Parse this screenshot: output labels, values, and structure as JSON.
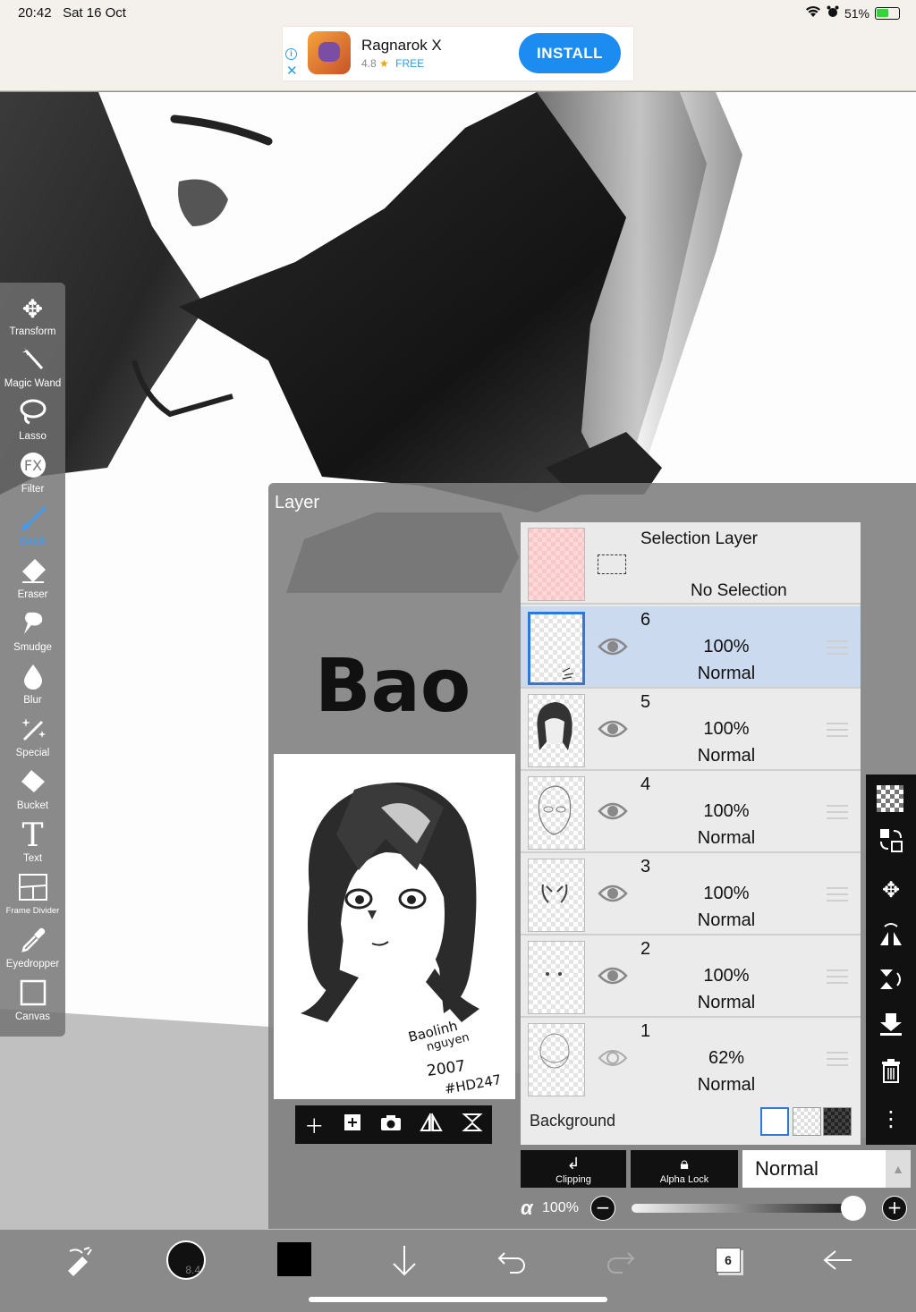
{
  "status_bar": {
    "time": "20:42",
    "date": "Sat 16 Oct",
    "battery": "51%"
  },
  "ad": {
    "title": "Ragnarok X",
    "rating": "4.8",
    "star": "★",
    "price": "FREE",
    "cta": "INSTALL"
  },
  "artwork": {
    "signature_lettering": "Bao"
  },
  "tools": [
    {
      "id": "transform",
      "label": "Transform",
      "icon": "move-icon"
    },
    {
      "id": "magic-wand",
      "label": "Magic Wand",
      "icon": "magic-wand-icon"
    },
    {
      "id": "lasso",
      "label": "Lasso",
      "icon": "lasso-icon"
    },
    {
      "id": "filter",
      "label": "Filter",
      "icon": "fx-icon"
    },
    {
      "id": "brush",
      "label": "Brush",
      "icon": "brush-icon",
      "active": true
    },
    {
      "id": "eraser",
      "label": "Eraser",
      "icon": "eraser-icon"
    },
    {
      "id": "smudge",
      "label": "Smudge",
      "icon": "smudge-icon"
    },
    {
      "id": "blur",
      "label": "Blur",
      "icon": "drop-icon"
    },
    {
      "id": "special",
      "label": "Special",
      "icon": "sparkle-icon"
    },
    {
      "id": "bucket",
      "label": "Bucket",
      "icon": "bucket-icon"
    },
    {
      "id": "text",
      "label": "Text",
      "icon": "text-icon"
    },
    {
      "id": "frame-divider",
      "label": "Frame Divider",
      "icon": "frame-icon"
    },
    {
      "id": "eyedropper",
      "label": "Eyedropper",
      "icon": "eyedropper-icon"
    },
    {
      "id": "canvas",
      "label": "Canvas",
      "icon": "canvas-icon"
    }
  ],
  "layer_panel": {
    "title": "Layer",
    "selection_layer": {
      "name": "Selection Layer",
      "state": "No Selection"
    },
    "layers": [
      {
        "num": "6",
        "opacity": "100%",
        "blend": "Normal",
        "selected": true,
        "visible": true
      },
      {
        "num": "5",
        "opacity": "100%",
        "blend": "Normal",
        "selected": false,
        "visible": true
      },
      {
        "num": "4",
        "opacity": "100%",
        "blend": "Normal",
        "selected": false,
        "visible": true
      },
      {
        "num": "3",
        "opacity": "100%",
        "blend": "Normal",
        "selected": false,
        "visible": true
      },
      {
        "num": "2",
        "opacity": "100%",
        "blend": "Normal",
        "selected": false,
        "visible": true
      },
      {
        "num": "1",
        "opacity": "62%",
        "blend": "Normal",
        "selected": false,
        "visible": false
      }
    ],
    "background_label": "Background",
    "clipping_label": "Clipping",
    "alpha_lock_label": "Alpha Lock",
    "blend_mode": "Normal",
    "alpha_symbol": "α",
    "alpha_value": "100%",
    "opacity_fraction": 1.0,
    "preview_signature": [
      "Baolinh",
      "nguyen",
      "2007",
      "#HD247"
    ]
  },
  "bottom_bar": {
    "brush_size": "8.4",
    "layer_count": "6",
    "color": "#000000"
  }
}
